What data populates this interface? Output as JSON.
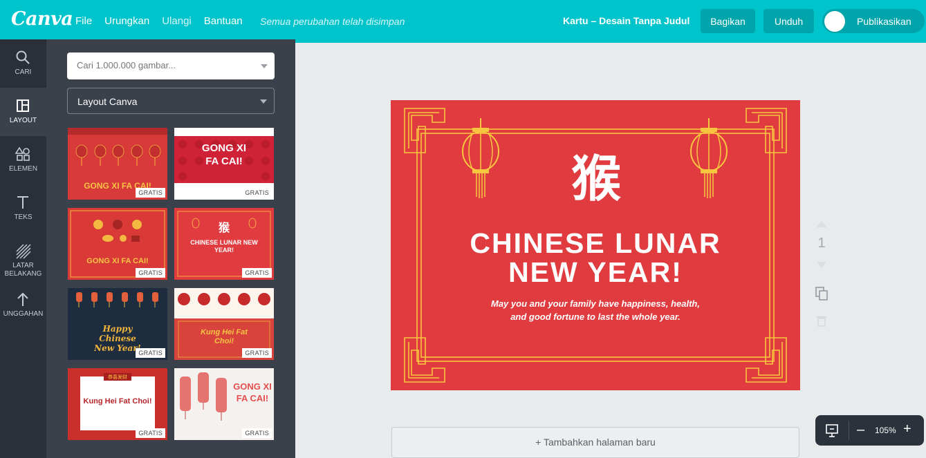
{
  "header": {
    "logo": "Canva",
    "menu": {
      "file": "File",
      "undo": "Urungkan",
      "redo": "Ulangi",
      "help": "Bantuan"
    },
    "save_status": "Semua perubahan telah disimpan",
    "doc_title": "Kartu – Desain Tanpa Judul",
    "share_label": "Bagikan",
    "download_label": "Unduh",
    "publish_label": "Publikasikan"
  },
  "sidebar": {
    "items": [
      {
        "label": "CARI",
        "icon": "search-icon"
      },
      {
        "label": "LAYOUT",
        "icon": "layout-icon"
      },
      {
        "label": "ELEMEN",
        "icon": "elements-icon"
      },
      {
        "label": "TEKS",
        "icon": "text-icon"
      },
      {
        "label": "LATAR BELAKANG",
        "icon": "background-icon"
      },
      {
        "label": "UNGGAHAN",
        "icon": "upload-icon"
      }
    ],
    "active": "LAYOUT"
  },
  "panel": {
    "search_placeholder": "Cari 1.000.000 gambar...",
    "layout_select": "Layout Canva",
    "templates": [
      {
        "title": "GONG XI FA CAI!",
        "badge": "GRATIS"
      },
      {
        "title": "GONG XI FA CAI!",
        "badge": "GRATIS"
      },
      {
        "title": "GONG XI FA CAI!",
        "badge": "GRATIS"
      },
      {
        "title": "CHINESE LUNAR NEW YEAR!",
        "badge": "GRATIS"
      },
      {
        "title": "Happy Chinese New Year!",
        "badge": "GRATIS"
      },
      {
        "title": "Kung Hei Fat Choi!",
        "badge": "GRATIS"
      },
      {
        "title": "Kung Hei Fat Choi!",
        "badge": "GRATIS"
      },
      {
        "title": "GONG XI FA CAI!",
        "badge": "GRATIS"
      }
    ]
  },
  "design": {
    "glyph": "猴",
    "headline_1": "CHINESE LUNAR",
    "headline_2": "NEW YEAR!",
    "message_1": "May you and your family have happiness, health,",
    "message_2": "and good fortune to last the whole year.",
    "background_color": "#e03c40",
    "accent_color": "#f8c63f"
  },
  "page": {
    "number": "1",
    "add_page_label": "+ Tambahkan halaman baru"
  },
  "zoom": {
    "value": "105%",
    "minus": "–",
    "plus": "+"
  },
  "colors": {
    "brand": "#00c4cc",
    "dark": "#293039",
    "panel": "#3a414b"
  }
}
